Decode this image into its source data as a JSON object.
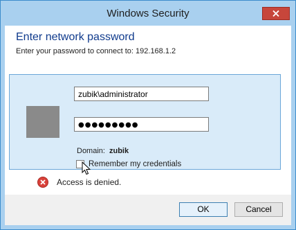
{
  "window": {
    "title": "Windows Security",
    "close_glyph": "✕"
  },
  "dialog": {
    "heading": "Enter network password",
    "subheading": "Enter your password to connect to: 192.168.1.2"
  },
  "credentials": {
    "username_value": "zubik\\administrator",
    "password_masked": "●●●●●●●●●",
    "domain_label": "Domain:",
    "domain_value": "zubik",
    "remember_label": "Remember my credentials",
    "remember_checked": false
  },
  "error": {
    "icon": "error-icon",
    "message": "Access is denied."
  },
  "buttons": {
    "ok_label": "OK",
    "cancel_label": "Cancel"
  },
  "colors": {
    "frame": "#a9d0ef",
    "heading": "#0f3a8c",
    "close_button": "#c7463b",
    "error_red": "#d9413a"
  }
}
